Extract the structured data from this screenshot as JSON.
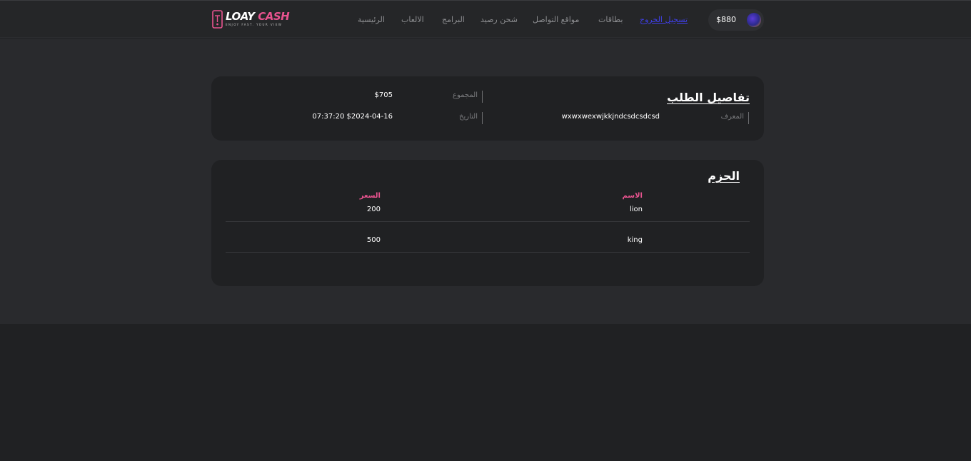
{
  "brand": {
    "name_part1": "LOAY",
    "name_part2": "CASH",
    "tagline": "ENJOY FAST. YOUR VIEW"
  },
  "nav": {
    "home": "الرئيسية",
    "games": "الالعاب",
    "programs": "البرامج",
    "topup": "شحن رصيد",
    "social": "مواقع التواصل",
    "cards": "بطاقات",
    "logout": "تسجيل الخروج"
  },
  "balance": "$880",
  "order": {
    "title": "تفاصيل الطلب",
    "id_label": "المعرف",
    "id_value": "wxwxwexwjkkjndcsdcsdcsd",
    "total_label": "المجموع",
    "total_value": "$705",
    "date_label": "التاريخ",
    "date_value": "07:37:20 $2024-04-16"
  },
  "packages": {
    "title": "الحزم",
    "columns": {
      "name": "الاسم",
      "price": "السعر"
    },
    "rows": [
      {
        "name": "lion",
        "price": "200"
      },
      {
        "name": "king",
        "price": "500"
      }
    ]
  },
  "colors": {
    "accent_pink": "#e8538f",
    "link_active": "#3f3fe6",
    "page_bg": "#202123",
    "card_bg": "#202123",
    "section_bg": "#292a2d"
  }
}
